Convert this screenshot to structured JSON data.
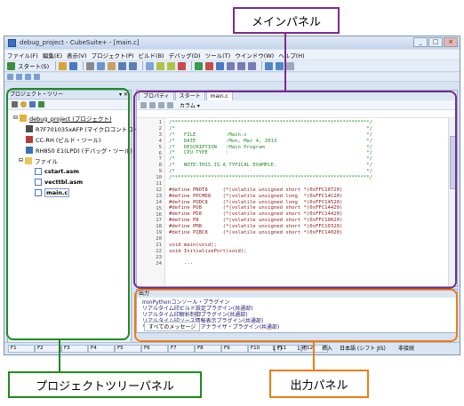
{
  "window": {
    "title": "debug_project - CubeSuite+ - [main.c]",
    "buttons": [
      "_",
      "□",
      "×"
    ]
  },
  "menu": [
    "ファイル(F)",
    "編集(E)",
    "表示(V)",
    "プロジェクト(P)",
    "ビルド(B)",
    "デバッグ(D)",
    "ツール(T)",
    "ウインドウ(W)",
    "ヘルプ(H)"
  ],
  "toolbar": {
    "start_label": "スタート(S)"
  },
  "project_panel": {
    "title": "プロジェクト・ツリー",
    "pin": "▾ ✕",
    "tree": [
      {
        "label": "debug_project (プロジェクト)",
        "level": 0,
        "icon": "project-icon"
      },
      {
        "label": "R7F701035xAFP (マイクロコントローラ)",
        "level": 1,
        "icon": "chip-icon"
      },
      {
        "label": "CC-RH (ビルド・ツール)",
        "level": 1,
        "icon": "tool-icon"
      },
      {
        "label": "RH850 E1(LPD) (デバッグ・ツール)",
        "level": 1,
        "icon": "debugger-icon"
      },
      {
        "label": "ファイル",
        "level": 1,
        "icon": "folder-icon"
      },
      {
        "label": "cstart.asm",
        "level": 2,
        "icon": "file-icon"
      },
      {
        "label": "vecttbl.asm",
        "level": 2,
        "icon": "file-icon"
      },
      {
        "label": "main.c",
        "level": 2,
        "icon": "file-icon"
      }
    ]
  },
  "editor": {
    "tabs": [
      "プロパティ",
      "スタート",
      "main.c"
    ],
    "toolbar_label": "カラム ▾",
    "code": [
      {
        "n": "1",
        "text": "/******************************************************************/",
        "kind": "comment"
      },
      {
        "n": "2",
        "text": "/*                                                                */",
        "kind": "comment"
      },
      {
        "n": "3",
        "text": "/*   FILE          :Main.c                                        */",
        "kind": "comment"
      },
      {
        "n": "4",
        "text": "/*   DATE          :Mon, Mar 4, 2013                              */",
        "kind": "comment"
      },
      {
        "n": "5",
        "text": "/*   DESCRIPTION   :Main Program                                  */",
        "kind": "comment"
      },
      {
        "n": "6",
        "text": "/*   CPU TYPE      :                                              */",
        "kind": "comment"
      },
      {
        "n": "7",
        "text": "/*                                                                */",
        "kind": "comment"
      },
      {
        "n": "8",
        "text": "/*   NOTE:THIS IS A TYPICAL EXAMPLE.                              */",
        "kind": "comment"
      },
      {
        "n": "9",
        "text": "/*                                                                */",
        "kind": "comment"
      },
      {
        "n": "10",
        "text": "/******************************************************************/",
        "kind": "comment"
      },
      {
        "n": "11",
        "text": "",
        "kind": "code"
      },
      {
        "n": "12",
        "text": "#define PNOT8     (*(volatile unsigned short *)0xFFC10720)",
        "kind": "code"
      },
      {
        "n": "13",
        "text": "#define PPCMD8    (*(volatile unsigned long  *)0xFFC14C20)",
        "kind": "code"
      },
      {
        "n": "14",
        "text": "#define PODC8     (*(volatile unsigned long  *)0xFFC14520)",
        "kind": "code"
      },
      {
        "n": "15",
        "text": "#define PU8       (*(volatile unsigned short *)0xFFC14420)",
        "kind": "code"
      },
      {
        "n": "16",
        "text": "#define PD8       (*(volatile unsigned short *)0xFFC14420)",
        "kind": "code"
      },
      {
        "n": "17",
        "text": "#define P8        (*(volatile unsigned short *)0xFFC10020)",
        "kind": "code"
      },
      {
        "n": "18",
        "text": "#define PM8       (*(volatile unsigned short *)0xFFC10320)",
        "kind": "code"
      },
      {
        "n": "19",
        "text": "#define PIBC8     (*(volatile unsigned short *)0xFFC14020)",
        "kind": "code"
      },
      {
        "n": "20",
        "text": "",
        "kind": "code"
      },
      {
        "n": "21",
        "text": "void main(void);",
        "kind": "code"
      },
      {
        "n": "22",
        "text": "void InitializePort(void);",
        "kind": "code"
      },
      {
        "n": "23",
        "text": "",
        "kind": "code"
      },
      {
        "n": "24",
        "text": "     ...",
        "kind": "code"
      }
    ]
  },
  "output_panel": {
    "title": "出力",
    "lines": [
      "IronPythonコンソール・プラグイン",
      "リアルタイム印ビルド設定プラグイン(共通部)",
      "リアルタイム印解析制御プラグイン(共通部)",
      "リアルタイム印ソース情報表示プラグイン(共通部)",
      "リアルタイム印タスク・アナライザ・プラグイン(共通部)"
    ],
    "tab": "すべてのメッセージ"
  },
  "statusbar": {
    "fkeys": [
      "F1",
      "F2",
      "F3",
      "F4",
      "F5",
      "F6",
      "F7",
      "F8",
      "F9",
      "F10",
      "F11",
      "F12"
    ],
    "line": "1 行",
    "col": "1 桁",
    "mode": "挿入",
    "encoding": "日本語 (シフト JIS)",
    "conn": "非接続"
  },
  "callouts": {
    "main_panel": "メインパネル",
    "project_tree_panel": "プロジェクトツリーパネル",
    "output_panel": "出力パネル"
  },
  "colors": {
    "main_panel": "#7b2b8e",
    "project_tree_panel": "#1f8a1f",
    "output_panel": "#f07c12"
  }
}
